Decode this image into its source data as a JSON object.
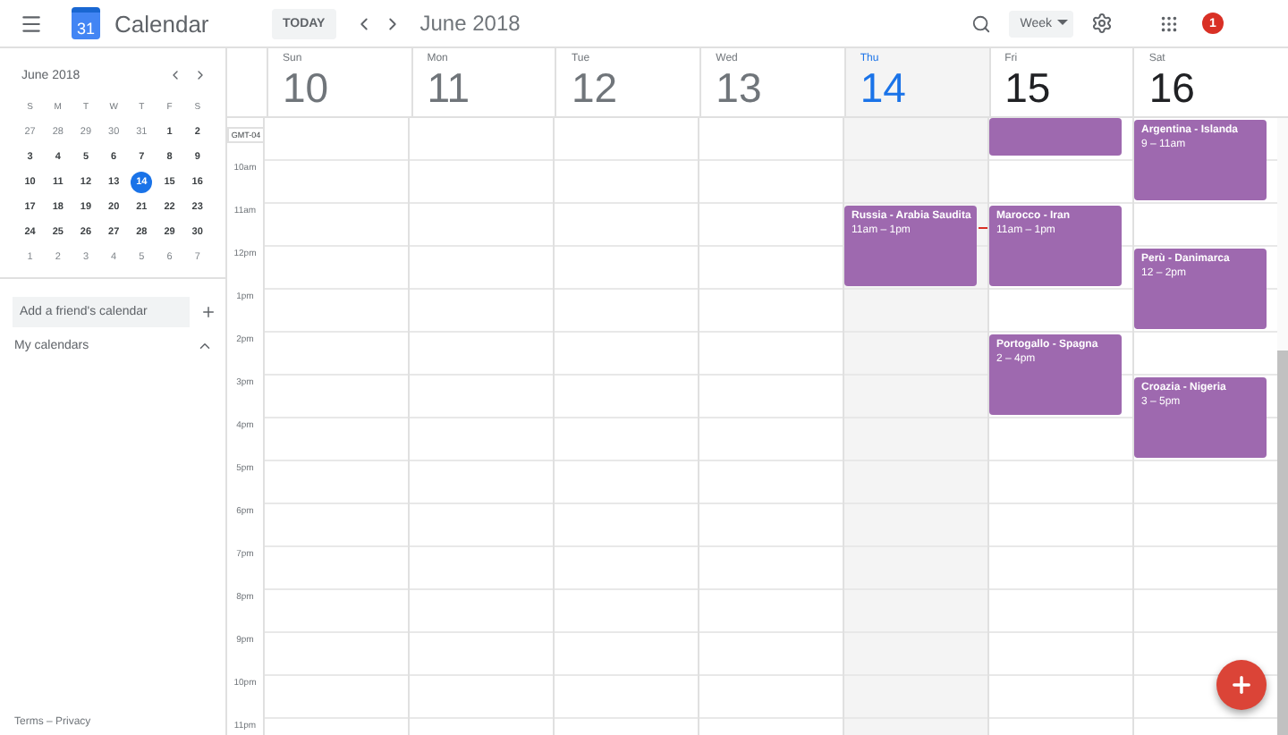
{
  "header": {
    "app_title": "Calendar",
    "logo_day": "31",
    "today_button": "TODAY",
    "period": "June 2018",
    "view": "Week",
    "notification_count": "1"
  },
  "mini_calendar": {
    "title": "June 2018",
    "weekdays": [
      "S",
      "M",
      "T",
      "W",
      "T",
      "F",
      "S"
    ],
    "weeks": [
      [
        {
          "label": "27",
          "muted": true,
          "selected": false
        },
        {
          "label": "28",
          "muted": true,
          "selected": false
        },
        {
          "label": "29",
          "muted": true,
          "selected": false
        },
        {
          "label": "30",
          "muted": true,
          "selected": false
        },
        {
          "label": "31",
          "muted": true,
          "selected": false
        },
        {
          "label": "1",
          "muted": false,
          "selected": false
        },
        {
          "label": "2",
          "muted": false,
          "selected": false
        }
      ],
      [
        {
          "label": "3",
          "muted": false,
          "selected": false
        },
        {
          "label": "4",
          "muted": false,
          "selected": false
        },
        {
          "label": "5",
          "muted": false,
          "selected": false
        },
        {
          "label": "6",
          "muted": false,
          "selected": false
        },
        {
          "label": "7",
          "muted": false,
          "selected": false
        },
        {
          "label": "8",
          "muted": false,
          "selected": false
        },
        {
          "label": "9",
          "muted": false,
          "selected": false
        }
      ],
      [
        {
          "label": "10",
          "muted": false,
          "selected": false
        },
        {
          "label": "11",
          "muted": false,
          "selected": false
        },
        {
          "label": "12",
          "muted": false,
          "selected": false
        },
        {
          "label": "13",
          "muted": false,
          "selected": false
        },
        {
          "label": "14",
          "muted": false,
          "selected": true
        },
        {
          "label": "15",
          "muted": false,
          "selected": false
        },
        {
          "label": "16",
          "muted": false,
          "selected": false
        }
      ],
      [
        {
          "label": "17",
          "muted": false,
          "selected": false
        },
        {
          "label": "18",
          "muted": false,
          "selected": false
        },
        {
          "label": "19",
          "muted": false,
          "selected": false
        },
        {
          "label": "20",
          "muted": false,
          "selected": false
        },
        {
          "label": "21",
          "muted": false,
          "selected": false
        },
        {
          "label": "22",
          "muted": false,
          "selected": false
        },
        {
          "label": "23",
          "muted": false,
          "selected": false
        }
      ],
      [
        {
          "label": "24",
          "muted": false,
          "selected": false
        },
        {
          "label": "25",
          "muted": false,
          "selected": false
        },
        {
          "label": "26",
          "muted": false,
          "selected": false
        },
        {
          "label": "27",
          "muted": false,
          "selected": false
        },
        {
          "label": "28",
          "muted": false,
          "selected": false
        },
        {
          "label": "29",
          "muted": false,
          "selected": false
        },
        {
          "label": "30",
          "muted": false,
          "selected": false
        }
      ],
      [
        {
          "label": "1",
          "muted": true,
          "selected": false
        },
        {
          "label": "2",
          "muted": true,
          "selected": false
        },
        {
          "label": "3",
          "muted": true,
          "selected": false
        },
        {
          "label": "4",
          "muted": true,
          "selected": false
        },
        {
          "label": "5",
          "muted": true,
          "selected": false
        },
        {
          "label": "6",
          "muted": true,
          "selected": false
        },
        {
          "label": "7",
          "muted": true,
          "selected": false
        }
      ]
    ]
  },
  "sidebar": {
    "friend_calendar": {
      "placeholder": "Add a friend's calendar"
    },
    "my_calendars": {
      "label": "My calendars",
      "expanded": true
    },
    "footer": "Terms – Privacy"
  },
  "week": {
    "timezone": "GMT-04",
    "hours": [
      "10am",
      "11am",
      "12pm",
      "1pm",
      "2pm",
      "3pm",
      "4pm",
      "5pm",
      "6pm",
      "7pm",
      "8pm",
      "9pm",
      "10pm",
      "11pm"
    ],
    "days": [
      {
        "name": "Sun",
        "number": "10",
        "past": true,
        "selected": false
      },
      {
        "name": "Mon",
        "number": "11",
        "past": true,
        "selected": false
      },
      {
        "name": "Tue",
        "number": "12",
        "past": true,
        "selected": false
      },
      {
        "name": "Wed",
        "number": "13",
        "past": true,
        "selected": false
      },
      {
        "name": "Thu",
        "number": "14",
        "past": false,
        "selected": true,
        "events": [
          {
            "kind": "full",
            "title": "Russia - Arabia Saudita",
            "time": "11am – 1pm"
          }
        ]
      },
      {
        "name": "Fri",
        "number": "15",
        "past": false,
        "selected": false,
        "events": [
          {
            "kind": "partial"
          },
          {
            "kind": "full",
            "title": "Marocco - Iran",
            "time": "11am – 1pm"
          },
          {
            "kind": "full",
            "title": "Portogallo - Spagna",
            "time": "2 – 4pm"
          }
        ]
      },
      {
        "name": "Sat",
        "number": "16",
        "past": false,
        "selected": false,
        "events": [
          {
            "kind": "full",
            "title": "Argentina - Islanda",
            "time": "9 – 11am"
          },
          {
            "kind": "full",
            "title": "Perù - Danimarca",
            "time": "12 – 2pm"
          },
          {
            "kind": "full",
            "title": "Croazia - Nigeria",
            "time": "3 – 5pm"
          }
        ]
      }
    ]
  }
}
